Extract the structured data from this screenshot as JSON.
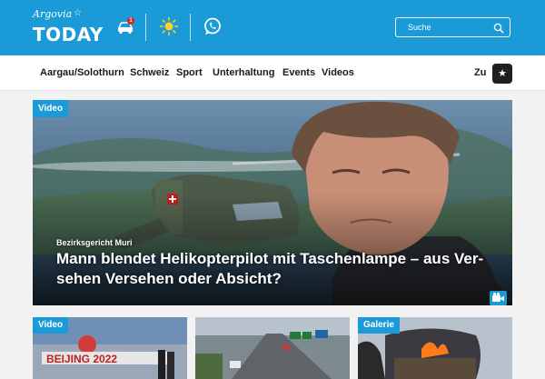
{
  "brand": {
    "logo_script": "Argovia",
    "logo_wordmark": "TODAY"
  },
  "header": {
    "traffic_badge": "1",
    "search_placeholder": "Suche"
  },
  "nav": {
    "items": [
      "Aargau/Solothurn",
      "Schweiz",
      "Sport",
      "Unterhaltung",
      "Events",
      "Videos"
    ],
    "zu_label": "Zu"
  },
  "hero": {
    "tag": "Video",
    "kicker": "Bezirksgericht Muri",
    "title": "Mann blendet Helikopterpilot mit Taschenlampe – aus Ver­sehen Versehen oder Absicht?"
  },
  "cards": [
    {
      "tag": "Video",
      "image_text": "BEIJING 2022"
    },
    {
      "tag": ""
    },
    {
      "tag": "Galerie"
    }
  ],
  "colors": {
    "brand_blue": "#1b9ad8",
    "nav_text": "#1a1a1a"
  },
  "icons": [
    "car-icon",
    "sun-icon",
    "whatsapp-icon",
    "search-icon",
    "radio-icon",
    "video-camera-icon"
  ]
}
